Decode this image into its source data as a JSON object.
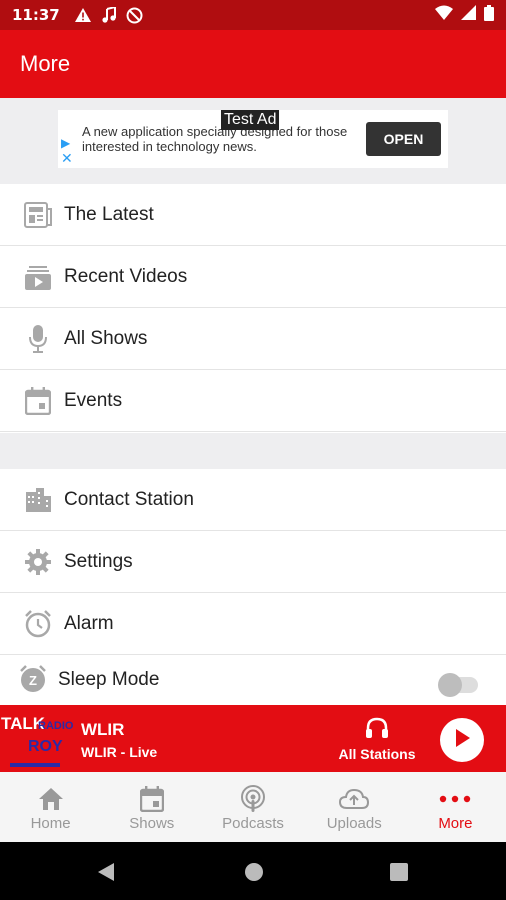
{
  "status_bar": {
    "time": "11:37"
  },
  "app_bar": {
    "title": "More"
  },
  "ad": {
    "tag": "Test Ad",
    "text": "A new application specially designed for those interested in technology news.",
    "open_label": "OPEN"
  },
  "menu_section1": [
    {
      "label": "The Latest",
      "icon": "newspaper-icon"
    },
    {
      "label": "Recent Videos",
      "icon": "video-library-icon"
    },
    {
      "label": "All Shows",
      "icon": "microphone-icon"
    },
    {
      "label": "Events",
      "icon": "calendar-icon"
    }
  ],
  "menu_section2": [
    {
      "label": "Contact Station",
      "icon": "building-icon"
    },
    {
      "label": "Settings",
      "icon": "gear-icon"
    },
    {
      "label": "Alarm",
      "icon": "alarm-clock-icon"
    },
    {
      "label": "Sleep Mode",
      "icon": "sleep-timer-icon",
      "toggle_on": false
    }
  ],
  "player": {
    "logo_text": [
      "TALK",
      "RADIO",
      "ROY"
    ],
    "station": "WLIR",
    "subtitle": "WLIR - Live",
    "all_stations_label": "All Stations"
  },
  "bottom_nav": [
    {
      "label": "Home",
      "icon": "home-icon",
      "active": false
    },
    {
      "label": "Shows",
      "icon": "calendar-icon",
      "active": false
    },
    {
      "label": "Podcasts",
      "icon": "podcast-icon",
      "active": false
    },
    {
      "label": "Uploads",
      "icon": "cloud-upload-icon",
      "active": false
    },
    {
      "label": "More",
      "icon": "more-dots-icon",
      "active": true
    }
  ],
  "colors": {
    "brand_red": "#e30d13",
    "status_red": "#b00d10",
    "icon_gray": "#a8a8a8"
  }
}
